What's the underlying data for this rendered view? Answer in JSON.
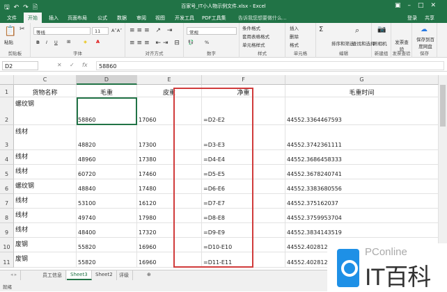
{
  "title": "百家号_IT小人物示例文件.xlsx - Excel",
  "quick_access": [
    "save-icon",
    "undo-icon",
    "redo-icon",
    "preview-icon"
  ],
  "menu_tabs": [
    "文件",
    "开始",
    "插入",
    "页面布局",
    "公式",
    "数据",
    "审阅",
    "视图",
    "开发工具",
    "PDF工具集"
  ],
  "tell_me": "告诉我您想要做什么...",
  "login": "登录",
  "share": "共享",
  "ribbon": {
    "clipboard": {
      "label": "剪贴板",
      "paste": "粘贴"
    },
    "font": {
      "label": "字体",
      "name": "等线",
      "size": "11",
      "bold": "B",
      "italic": "I",
      "underline": "U"
    },
    "align": {
      "label": "对齐方式"
    },
    "number": {
      "label": "数字",
      "format": "常规",
      "percent": "%"
    },
    "styles": {
      "label": "样式",
      "items": [
        "条件格式",
        "套用表格格式",
        "单元格样式"
      ]
    },
    "cells": {
      "label": "单元格",
      "items": [
        "插入",
        "删除",
        "格式"
      ]
    },
    "editing": {
      "label": "编辑",
      "sort": "排序和筛选",
      "find": "查找和选择"
    },
    "new_group": {
      "label": "新建组",
      "camera": "照相机"
    },
    "invoice": {
      "label": "发票查验",
      "btn": "发票查验"
    },
    "save": {
      "label": "保存",
      "btn": "保存到百度网盘"
    }
  },
  "formula_bar": {
    "name_box": "D2",
    "fx": "fx",
    "value": "58860"
  },
  "columns": [
    "C",
    "D",
    "E",
    "F",
    "G"
  ],
  "rows": [
    {
      "n": "1",
      "c": "货物名称",
      "d": "毛重",
      "e": "皮重",
      "f": "净重",
      "g": "毛重时间"
    },
    {
      "n": "2",
      "c": "螺纹钢",
      "d": "58860",
      "e": "17060",
      "f": "=D2-E2",
      "g": "44552.3364467593"
    },
    {
      "n": "3",
      "c": "线材",
      "d": "48820",
      "e": "17300",
      "f": "=D3-E3",
      "g": "44552.3742361111"
    },
    {
      "n": "4",
      "c": "线材",
      "d": "48960",
      "e": "17380",
      "f": "=D4-E4",
      "g": "44552.3686458333"
    },
    {
      "n": "5",
      "c": "线材",
      "d": "60720",
      "e": "17460",
      "f": "=D5-E5",
      "g": "44552.3678240741"
    },
    {
      "n": "6",
      "c": "螺纹钢",
      "d": "48840",
      "e": "17480",
      "f": "=D6-E6",
      "g": "44552.3383680556"
    },
    {
      "n": "7",
      "c": "线材",
      "d": "53100",
      "e": "16120",
      "f": "=D7-E7",
      "g": "44552.375162037"
    },
    {
      "n": "8",
      "c": "线材",
      "d": "49740",
      "e": "17980",
      "f": "=D8-E8",
      "g": "44552.3759953704"
    },
    {
      "n": "9",
      "c": "线材",
      "d": "48400",
      "e": "17320",
      "f": "=D9-E9",
      "g": "44552.3834143519"
    },
    {
      "n": "10",
      "c": "废钢",
      "d": "55820",
      "e": "16960",
      "f": "=D10-E10",
      "g": "44552.4028125"
    },
    {
      "n": "11",
      "c": "废钢",
      "d": "55820",
      "e": "16960",
      "f": "=D11-E11",
      "g": "44552.4028125"
    }
  ],
  "sheets": [
    "员工信息",
    "Sheet3",
    "Sheet2",
    "评级"
  ],
  "active_sheet": "Sheet3",
  "status": "就绪",
  "watermark": {
    "top": "PConline",
    "main": "IT百科"
  }
}
